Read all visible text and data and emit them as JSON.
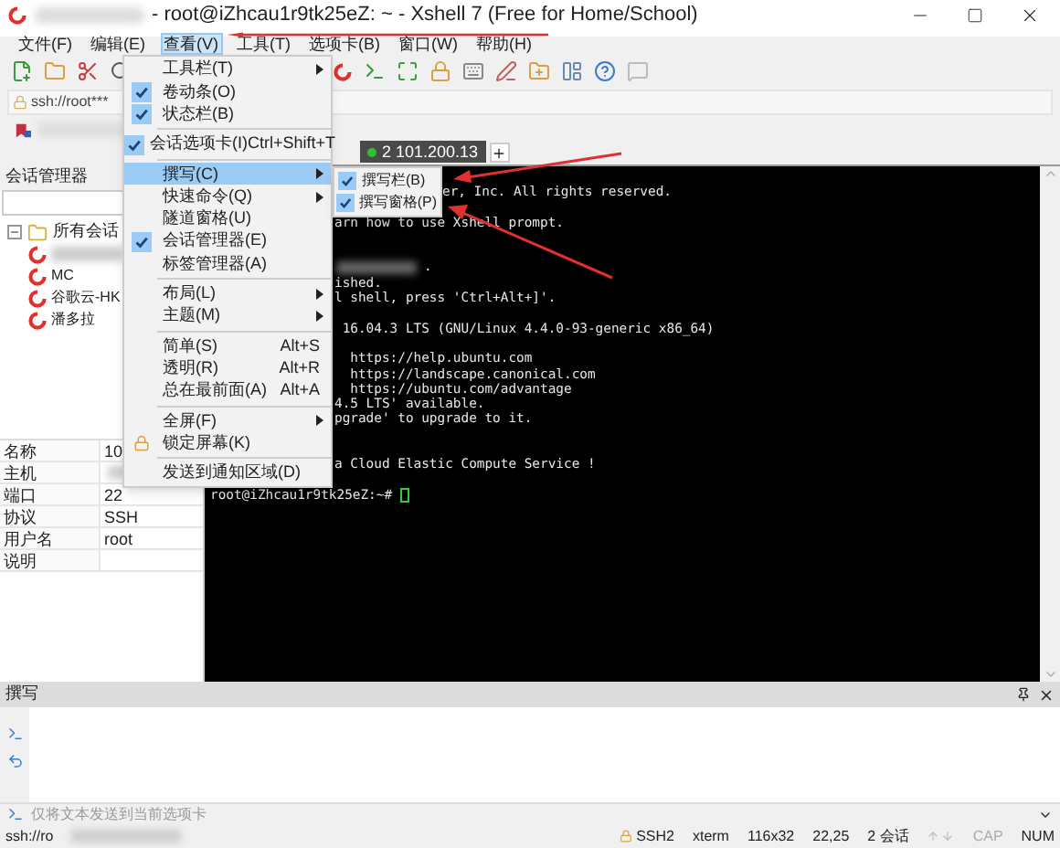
{
  "window": {
    "title": "- root@iZhcau1r9tk25eZ: ~ - Xshell 7 (Free for Home/School)"
  },
  "menubar": [
    {
      "label": "文件(F)",
      "selected": false
    },
    {
      "label": "编辑(E)",
      "selected": false
    },
    {
      "label": "查看(V)",
      "selected": true
    },
    {
      "label": "工具(T)",
      "selected": false
    },
    {
      "label": "选项卡(B)",
      "selected": false
    },
    {
      "label": "窗口(W)",
      "selected": false
    },
    {
      "label": "帮助(H)",
      "selected": false
    }
  ],
  "address_bar": {
    "value": "ssh://root***"
  },
  "view_menu": [
    {
      "kind": "item",
      "label": "工具栏(T)",
      "checked": false,
      "submenu": true,
      "selected": false
    },
    {
      "kind": "item",
      "label": "卷动条(O)",
      "checked": true,
      "submenu": false,
      "selected": false
    },
    {
      "kind": "item",
      "label": "状态栏(B)",
      "checked": true,
      "submenu": false,
      "selected": false
    },
    {
      "kind": "separator"
    },
    {
      "kind": "item",
      "label": "会话选项卡(I)",
      "shortcut": "Ctrl+Shift+T",
      "checked": true,
      "submenu": false,
      "selected": false
    },
    {
      "kind": "separator"
    },
    {
      "kind": "item",
      "label": "撰写(C)",
      "checked": false,
      "submenu": true,
      "selected": true
    },
    {
      "kind": "item",
      "label": "快速命令(Q)",
      "checked": false,
      "submenu": true,
      "selected": false
    },
    {
      "kind": "item",
      "label": "隧道窗格(U)",
      "checked": false,
      "submenu": false,
      "selected": false
    },
    {
      "kind": "item",
      "label": "会话管理器(E)",
      "checked": true,
      "submenu": false,
      "selected": false
    },
    {
      "kind": "item",
      "label": "标签管理器(A)",
      "checked": false,
      "submenu": false,
      "selected": false
    },
    {
      "kind": "separator"
    },
    {
      "kind": "item",
      "label": "布局(L)",
      "checked": false,
      "submenu": true,
      "selected": false
    },
    {
      "kind": "item",
      "label": "主题(M)",
      "checked": false,
      "submenu": true,
      "selected": false
    },
    {
      "kind": "separator"
    },
    {
      "kind": "item",
      "label": "简单(S)",
      "shortcut": "Alt+S",
      "checked": false,
      "submenu": false,
      "selected": false
    },
    {
      "kind": "item",
      "label": "透明(R)",
      "shortcut": "Alt+R",
      "checked": false,
      "submenu": false,
      "selected": false
    },
    {
      "kind": "item",
      "label": "总在最前面(A)",
      "shortcut": "Alt+A",
      "checked": false,
      "submenu": false,
      "selected": false
    },
    {
      "kind": "separator"
    },
    {
      "kind": "item",
      "label": "全屏(F)",
      "checked": false,
      "submenu": true,
      "selected": false
    },
    {
      "kind": "lock",
      "label": "锁定屏幕(K)",
      "checked": false,
      "submenu": false,
      "selected": false
    },
    {
      "kind": "separator"
    },
    {
      "kind": "item",
      "label": "发送到通知区域(D)",
      "checked": false,
      "submenu": false,
      "selected": false
    }
  ],
  "compose_submenu": [
    {
      "label": "撰写栏(B)",
      "checked": true
    },
    {
      "label": "撰写窗格(P)",
      "checked": true
    }
  ],
  "session_manager": {
    "title": "会话管理器",
    "tree": [
      {
        "label": "所有会话",
        "expanded": true,
        "children": [
          {
            "blurred": true
          },
          {
            "label": "MC"
          },
          {
            "label": "谷歌云-HK"
          },
          {
            "label": "潘多拉"
          }
        ]
      }
    ],
    "properties": [
      {
        "name": "名称",
        "value": "10"
      },
      {
        "name": "主机",
        "blurred": true
      },
      {
        "name": "端口",
        "value": "22"
      },
      {
        "name": "协议",
        "value": "SSH"
      },
      {
        "name": "用户名",
        "value": "root"
      },
      {
        "name": "说明"
      }
    ]
  },
  "tabs": [
    {
      "label": "2 101.200.13",
      "selected": true,
      "connected": true
    }
  ],
  "terminal": {
    "lines": [
      {
        "kind": "covered",
        "text": "er, Inc. All rights reserved."
      },
      {
        "kind": "blank"
      },
      {
        "kind": "text",
        "text": "arn how to use Xshell prompt."
      },
      {
        "kind": "blank"
      },
      {
        "kind": "blank"
      },
      {
        "kind": "blurred",
        "text": "."
      },
      {
        "kind": "text",
        "text": "ished."
      },
      {
        "kind": "text",
        "text": "l shell, press 'Ctrl+Alt+]'."
      },
      {
        "kind": "blank"
      },
      {
        "kind": "text",
        "text": " 16.04.3 LTS (GNU/Linux 4.4.0-93-generic x86_64)"
      },
      {
        "kind": "blank"
      },
      {
        "kind": "text",
        "text": "  https://help.ubuntu.com"
      },
      {
        "kind": "text",
        "text": "  https://landscape.canonical.com"
      },
      {
        "kind": "text",
        "text": "  https://ubuntu.com/advantage"
      },
      {
        "kind": "text",
        "text": "4.5 LTS' available."
      },
      {
        "kind": "text",
        "text": "pgrade' to upgrade to it."
      },
      {
        "kind": "blank"
      },
      {
        "kind": "blank"
      },
      {
        "kind": "text",
        "text": "a Cloud Elastic Compute Service !"
      },
      {
        "kind": "blank"
      },
      {
        "kind": "prompt",
        "text": "root@iZhcau1r9tk25eZ:~# "
      }
    ]
  },
  "compose": {
    "title": "撰写",
    "placeholder": "仅将文本发送到当前选项卡"
  },
  "status_bar": {
    "address": "ssh://ro",
    "protocol": "SSH2",
    "terminal": "xterm",
    "size": "116x32",
    "cursor": "22,25",
    "sessions": "2 会话",
    "caps": "CAP",
    "num": "NUM"
  }
}
